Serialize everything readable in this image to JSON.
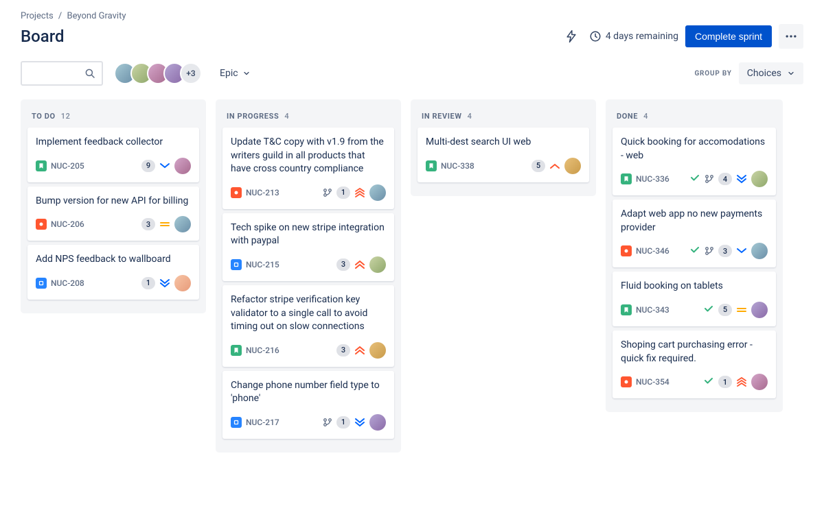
{
  "breadcrumb": {
    "parent": "Projects",
    "sep": "/",
    "current": "Beyond Gravity"
  },
  "page_title": "Board",
  "header": {
    "remaining": "4 days remaining",
    "complete_btn": "Complete sprint"
  },
  "toolbar": {
    "epic_label": "Epic",
    "avatars_more": "+3",
    "group_by_label": "GROUP BY",
    "group_by_value": "Choices"
  },
  "columns": [
    {
      "name": "TO DO",
      "count": "12",
      "cards": [
        {
          "title": "Implement feedback collector",
          "type": "story",
          "key": "NUC-205",
          "points": "9",
          "priority": "low",
          "avatar": "av3"
        },
        {
          "title": "Bump version for new API for billing",
          "type": "bug",
          "key": "NUC-206",
          "points": "3",
          "priority": "medium",
          "avatar": "av4"
        },
        {
          "title": "Add NPS feedback to wallboard",
          "type": "task",
          "key": "NUC-208",
          "points": "1",
          "priority": "lowest",
          "avatar": "av1"
        }
      ]
    },
    {
      "name": "IN PROGRESS",
      "count": "4",
      "cards": [
        {
          "title": "Update T&C copy with v1.9 from the writers guild in all products that have cross country compliance",
          "type": "bug",
          "key": "NUC-213",
          "branch": true,
          "points": "1",
          "priority": "highest",
          "avatar": "av4"
        },
        {
          "title": "Tech spike on new stripe integration with paypal",
          "type": "task",
          "key": "NUC-215",
          "points": "3",
          "priority": "high",
          "avatar": "av2"
        },
        {
          "title": "Refactor stripe verification key validator to a single call to avoid timing out on slow connections",
          "type": "story",
          "key": "NUC-216",
          "points": "3",
          "priority": "high",
          "avatar": "av5"
        },
        {
          "title": "Change phone number field type to 'phone'",
          "type": "task",
          "key": "NUC-217",
          "branch": true,
          "points": "1",
          "priority": "lowest",
          "avatar": "av6"
        }
      ]
    },
    {
      "name": "IN REVIEW",
      "count": "4",
      "cards": [
        {
          "title": "Multi-dest search UI web",
          "type": "story",
          "key": "NUC-338",
          "points": "5",
          "priority": "high-single",
          "avatar": "av5"
        }
      ]
    },
    {
      "name": "DONE",
      "count": "4",
      "cards": [
        {
          "title": "Quick booking for accomodations - web",
          "type": "story",
          "key": "NUC-336",
          "done": true,
          "branch": true,
          "points": "4",
          "priority": "lowest",
          "avatar": "av2"
        },
        {
          "title": "Adapt web app no new payments provider",
          "type": "bug",
          "key": "NUC-346",
          "done": true,
          "branch": true,
          "points": "3",
          "priority": "low",
          "avatar": "av4"
        },
        {
          "title": "Fluid booking on tablets",
          "type": "story",
          "key": "NUC-343",
          "done": true,
          "points": "5",
          "priority": "medium",
          "avatar": "av6"
        },
        {
          "title": "Shoping cart purchasing error - quick fix required.",
          "type": "bug",
          "key": "NUC-354",
          "done": true,
          "points": "1",
          "priority": "highest",
          "avatar": "av3"
        }
      ]
    }
  ]
}
